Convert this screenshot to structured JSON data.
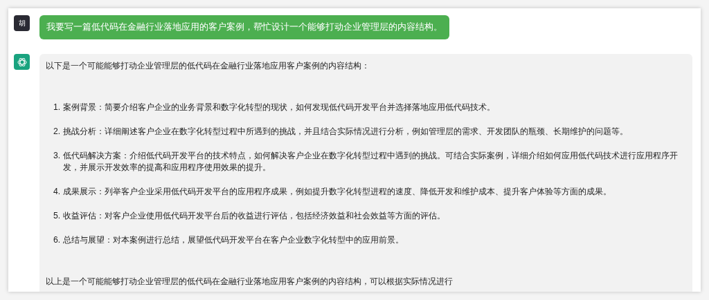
{
  "messages": [
    {
      "kind": "user",
      "avatar": "胡",
      "text": "我要写一篇低代码在金融行业落地应用的客户案例，帮忙设计一个能够打动企业管理层的内容结构。"
    },
    {
      "kind": "assistant",
      "intro": "以下是一个可能能够打动企业管理层的低代码在金融行业落地应用客户案例的内容结构：",
      "items": [
        {
          "number": "1.",
          "text": "案例背景：简要介绍客户企业的业务背景和数字化转型的现状，如何发现低代码开发平台并选择落地应用低代码技术。"
        },
        {
          "number": "2.",
          "text": "挑战分析：详细阐述客户企业在数字化转型过程中所遇到的挑战，并且结合实际情况进行分析，例如管理层的需求、开发团队的瓶颈、长期维护的问题等。"
        },
        {
          "number": "3.",
          "text": "低代码解决方案：介绍低代码开发平台的技术特点，如何解决客户企业在数字化转型过程中遇到的挑战。可结合实际案例，详细介绍如何应用低代码技术进行应用程序开发，并展示开发效率的提高和应用程序使用效果的提升。"
        },
        {
          "number": "4.",
          "text": "成果展示：列举客户企业采用低代码开发平台的应用程序成果，例如提升数字化转型进程的速度、降低开发和维护成本、提升客户体验等方面的成果。"
        },
        {
          "number": "5.",
          "text": "收益评估：对客户企业使用低代码开发平台后的收益进行评估，包括经济效益和社会效益等方面的评估。"
        },
        {
          "number": "6.",
          "text": "总结与展望：对本案例进行总结，展望低代码开发平台在客户企业数字化转型中的应用前景。"
        }
      ],
      "outro": "以上是一个可能能够打动企业管理层的低代码在金融行业落地应用客户案例的内容结构，可以根据实际情况进行"
    }
  ]
}
